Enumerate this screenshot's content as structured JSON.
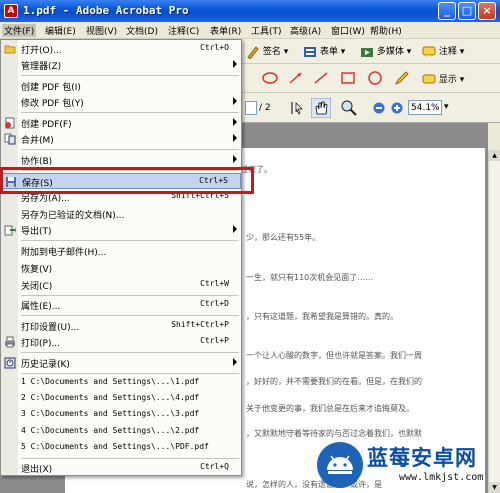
{
  "window": {
    "title": "1.pdf - Adobe Acrobat Pro",
    "app_icon_text": "A",
    "minimize": "_",
    "maximize": "□",
    "close": "×"
  },
  "menubar": [
    "文件(F)",
    "编辑(E)",
    "视图(V)",
    "文档(D)",
    "注释(C)",
    "表单(R)",
    "工具(T)",
    "高级(A)",
    "窗口(W)",
    "帮助(H)"
  ],
  "toolbar": {
    "sign": "签名",
    "forms": "表单",
    "multimedia": "多媒体",
    "comment": "注释",
    "show": "显示",
    "page_suffix": "/ 2",
    "zoom": "54.1%"
  },
  "file_menu": {
    "open": {
      "label": "打开(O)...",
      "shortcut": "Ctrl+O"
    },
    "organizer": {
      "label": "管理器(Z)"
    },
    "create_pdf_package": {
      "label": "创建 PDF 包(I)"
    },
    "modify_pdf_package": {
      "label": "修改 PDF 包(Y)"
    },
    "create_pdf": {
      "label": "创建 PDF(F)"
    },
    "combine": {
      "label": "合并(M)"
    },
    "collaborate": {
      "label": "协作(B)"
    },
    "save": {
      "label": "保存(S)",
      "shortcut": "Ctrl+S"
    },
    "save_as": {
      "label": "另存为(A)...",
      "shortcut": "Shift+Ctrl+S"
    },
    "save_as_certified": {
      "label": "另存为已验证的文档(N)..."
    },
    "export": {
      "label": "导出(T)"
    },
    "attach_email": {
      "label": "附加到电子邮件(H)..."
    },
    "revert": {
      "label": "恢复(V)"
    },
    "close": {
      "label": "关闭(C)",
      "shortcut": "Ctrl+W"
    },
    "properties": {
      "label": "属性(E)...",
      "shortcut": "Ctrl+D"
    },
    "print_setup": {
      "label": "打印设置(U)...",
      "shortcut": "Shift+Ctrl+P"
    },
    "print": {
      "label": "打印(P)...",
      "shortcut": "Ctrl+P"
    },
    "history": {
      "label": "历史记录(K)"
    },
    "recent": [
      "1 C:\\Documents and Settings\\...\\1.pdf",
      "2 C:\\Documents and Settings\\...\\4.pdf",
      "3 C:\\Documents and Settings\\...\\3.pdf",
      "4 C:\\Documents and Settings\\...\\2.pdf",
      "5 C:\\Documents and Settings\\...\\PDF.pdf"
    ],
    "exit": {
      "label": "退出(X)",
      "shortcut": "Ctrl+Q"
    }
  },
  "document_lines": [
    "已经半年没有回过家了。",
    "少，那么还有55年。",
    "一生，就只有110次机会见面了……",
    "，只有这道题，我希望我是算错的。真的。",
    "一个让人心酸的数字，但也许就是答案。我们一周",
    "，好好的，并不需要我们的在看。但是，在我们的",
    "关于他变更的事，我们总是在后来才追悔莫及。",
    "，又默默地守着等待家的与否过念着我们，也默默",
    "说，怎样的人，没有遗憾呢，或许，是"
  ],
  "watermark": {
    "text": "蓝莓安卓网",
    "url": "www.lmkjst.com"
  }
}
